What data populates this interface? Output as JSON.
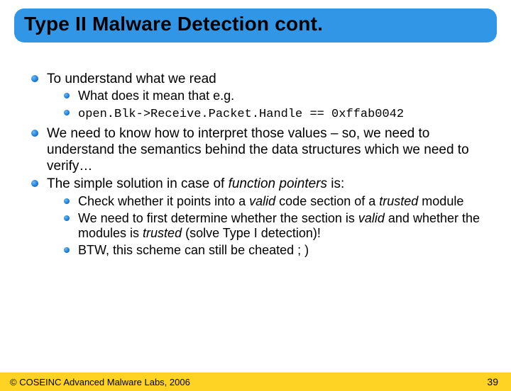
{
  "title": "Type II Malware Detection cont.",
  "bullets": {
    "b1": "To understand what we read",
    "b1a": "What does it mean that e.g.",
    "b1b": "open.Blk->Receive.Packet.Handle == 0xffab0042",
    "b2": "We need to know how to interpret those values – so, we need to understand the semantics behind the data structures which we need to verify…",
    "b3_pre": "The simple solution in case of ",
    "b3_em": "function pointers",
    "b3_post": " is:",
    "b3a_pre": "Check whether it points into a ",
    "b3a_em1": "valid",
    "b3a_mid": " code section of a ",
    "b3a_em2": "trusted",
    "b3a_post": " module",
    "b3b_pre": "We need to first determine whether the section is ",
    "b3b_em1": "valid",
    "b3b_mid": " and whether the modules is ",
    "b3b_em2": "trusted",
    "b3b_post": " (solve Type I detection)!",
    "b3c": "BTW, this scheme can still be cheated ; )"
  },
  "footer": {
    "copyright": "© COSEINC Advanced Malware Labs, 2006",
    "page": "39"
  }
}
